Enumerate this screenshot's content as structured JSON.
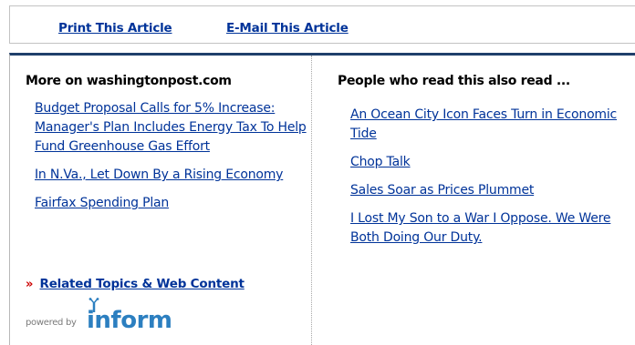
{
  "toolbar": {
    "print_label": "Print This Article",
    "email_label": "E-Mail This Article"
  },
  "left_column": {
    "heading": "More on washingtonpost.com",
    "links": [
      "Budget Proposal Calls for 5% Increase: Manager's Plan Includes Energy Tax To Help Fund Greenhouse Gas Effort",
      "In N.Va., Let Down By a Rising Economy",
      "Fairfax Spending Plan"
    ],
    "related_prefix": "»",
    "related_label": "Related Topics & Web Content",
    "powered_by": "powered by",
    "logo_word": "inform"
  },
  "right_column": {
    "heading": "People who read this also read ...",
    "links": [
      "An Ocean City Icon Faces Turn in Economic Tide",
      "Chop Talk",
      "Sales Soar as Prices Plummet",
      "I Lost My Son to a War I Oppose. We Were Both Doing Our Duty."
    ]
  },
  "colors": {
    "link": "#003399",
    "accent_bar": "#1f3f6b",
    "chevron": "#cc0000",
    "logo": "#2c7fc0"
  }
}
